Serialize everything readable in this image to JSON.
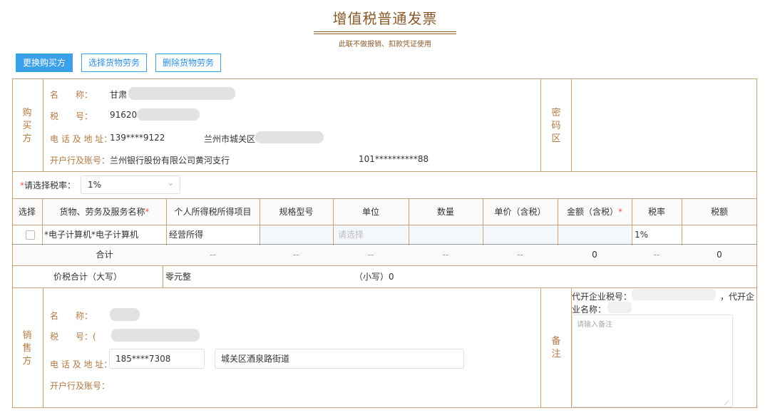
{
  "header": {
    "title": "增值税普通发票",
    "subtitle": "此联不做报销、扣款凭证使用"
  },
  "toolbar": {
    "change_buyer": "更换购买方",
    "select_goods": "选择货物劳务",
    "delete_goods": "删除货物劳务"
  },
  "buyer": {
    "section_label": "购买方",
    "name_label": "名　　称：",
    "name_value": "甘肃",
    "tax_label": "税　　号：",
    "tax_value": "91620",
    "addr_label": "电 话 及 地 址：",
    "phone_value": "139****9122",
    "addr_value": "兰州市城关区",
    "bank_label": "开户行及账号：",
    "bank_value": "兰州银行股份有限公司黄河支行",
    "account_value": "101**********88"
  },
  "password_area_label": "密码区",
  "tax_rate": {
    "required": "*",
    "label": "请选择税率：",
    "value": "1%"
  },
  "table": {
    "headers": [
      "选择",
      "货物、劳务及服务名称",
      "个人所得税所得项目",
      "规格型号",
      "单位",
      "数量",
      "单价（含税）",
      "金额（含税）",
      "税率",
      "税额"
    ],
    "required_mark": "*",
    "row": {
      "name": "*电子计算机*电子计算机",
      "item": "经营所得",
      "unit_placeholder": "请选择",
      "rate": "1%"
    },
    "total": {
      "label": "合计",
      "dash": "--",
      "amount": "0",
      "tax": "0"
    },
    "grand_total": {
      "label": "价税合计（大写）",
      "upper": "零元整",
      "lower_label": "（小写）",
      "lower_value": "0"
    }
  },
  "seller": {
    "section_label": "销售方",
    "name_label": "名　　称：",
    "tax_label": "税　　号：(",
    "addr_label": "电 话 及 地 址：",
    "phone_value": "185****7308",
    "addr_value": "城关区酒泉路街道",
    "bank_label": "开户行及账号："
  },
  "remark": {
    "label": "备注",
    "agent_tax_label": "代开企业税号：",
    "agent_tax_suffix": "，代开企",
    "agent_name_label": "业名称：",
    "placeholder": "请输入备注"
  },
  "colors": {
    "accent": "#3aa0e8",
    "border": "#c9a27a",
    "label": "#b07a45",
    "title": "#8b5a2b"
  }
}
